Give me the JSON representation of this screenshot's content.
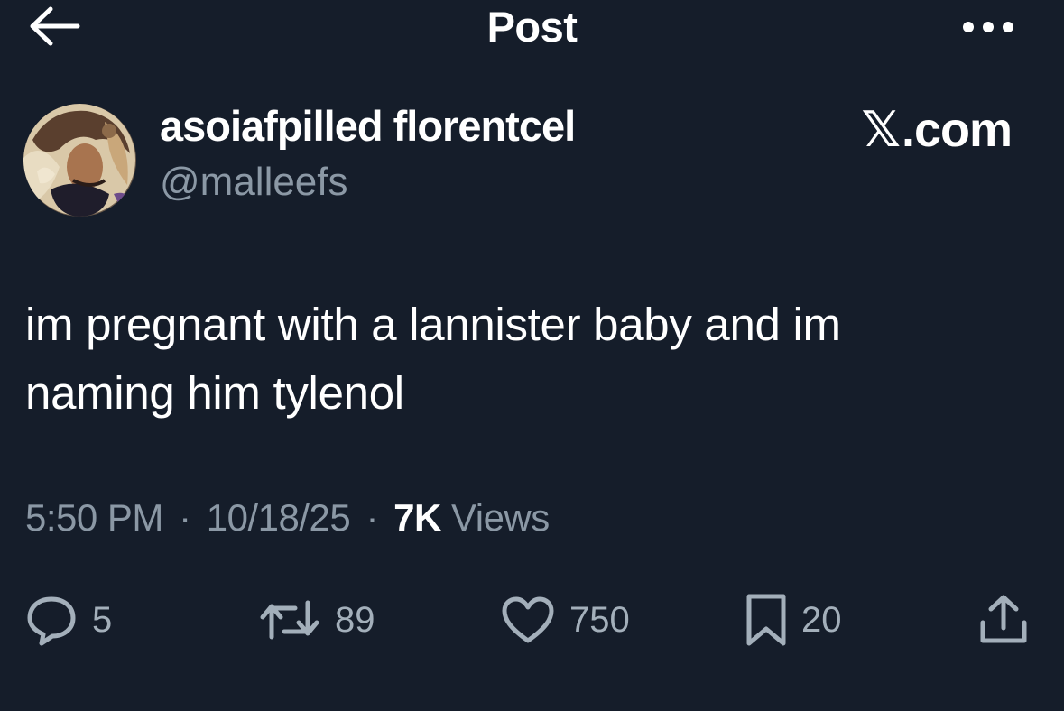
{
  "header": {
    "title": "Post",
    "back_icon": "arrow-left-icon",
    "more_icon": "more-horizontal-icon"
  },
  "author": {
    "display_name": "asoiafpilled florentcel",
    "handle": "@malleefs",
    "avatar": "illustrated-avatar"
  },
  "source": {
    "logo_glyph": "𝕏",
    "domain": ".com"
  },
  "post": {
    "text_line1": "im pregnant with a lannister baby and im",
    "text_line2": "naming him tylenol"
  },
  "meta": {
    "time": "5:50 PM",
    "date": "10/18/25",
    "views_count": "7K",
    "views_label": "Views",
    "separator": "·"
  },
  "actions": {
    "replies": "5",
    "reposts": "89",
    "likes": "750",
    "bookmarks": "20"
  },
  "colors": {
    "background": "#151d2a",
    "text": "#ffffff",
    "secondary_text": "#8b98a5",
    "icon": "#a3afba"
  }
}
